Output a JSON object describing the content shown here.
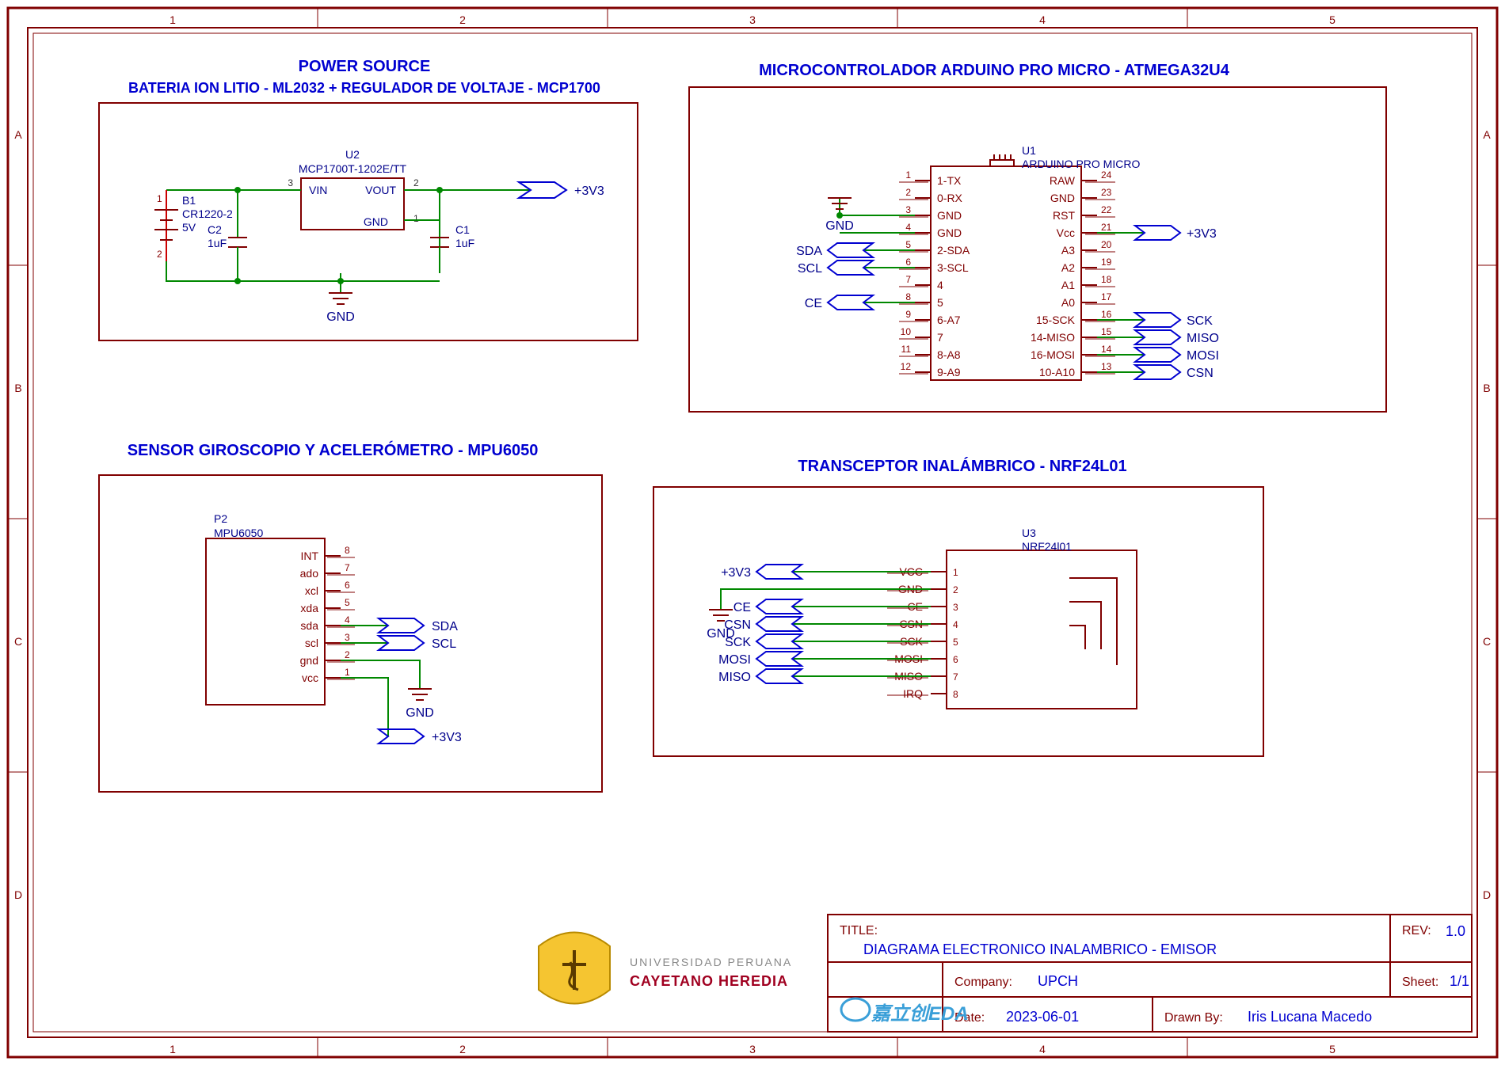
{
  "frame": {
    "cols": [
      "1",
      "2",
      "3",
      "4",
      "5"
    ],
    "rows": [
      "A",
      "B",
      "C",
      "D"
    ]
  },
  "sections": {
    "power": {
      "heading1": "POWER SOURCE",
      "heading2": "BATERIA ION LITIO - ML2032 + REGULADOR DE VOLTAJE - MCP1700",
      "b1": {
        "ref": "B1",
        "pn": "CR1220-2",
        "v": "5V"
      },
      "c2": {
        "ref": "C2",
        "val": "1uF"
      },
      "c1": {
        "ref": "C1",
        "val": "1uF"
      },
      "u2": {
        "ref": "U2",
        "pn": "MCP1700T-1202E/TT",
        "pins": {
          "vin": "VIN",
          "vout": "VOUT",
          "gnd": "GND",
          "p1": "1",
          "p2": "2",
          "p3": "3"
        }
      },
      "gnd": "GND",
      "out": "+3V3"
    },
    "mcu": {
      "heading": "MICROCONTROLADOR ARDUINO PRO MICRO - ATMEGA32U4",
      "u1": {
        "ref": "U1",
        "pn": "ARDUINO PRO MICRO"
      },
      "left_pins": [
        {
          "n": "1",
          "name": "1-TX"
        },
        {
          "n": "2",
          "name": "0-RX"
        },
        {
          "n": "3",
          "name": "GND"
        },
        {
          "n": "4",
          "name": "GND"
        },
        {
          "n": "5",
          "name": "2-SDA"
        },
        {
          "n": "6",
          "name": "3-SCL"
        },
        {
          "n": "7",
          "name": "4"
        },
        {
          "n": "8",
          "name": "5"
        },
        {
          "n": "9",
          "name": "6-A7"
        },
        {
          "n": "10",
          "name": "7"
        },
        {
          "n": "11",
          "name": "8-A8"
        },
        {
          "n": "12",
          "name": "9-A9"
        }
      ],
      "right_pins": [
        {
          "n": "24",
          "name": "RAW"
        },
        {
          "n": "23",
          "name": "GND"
        },
        {
          "n": "22",
          "name": "RST"
        },
        {
          "n": "21",
          "name": "Vcc"
        },
        {
          "n": "20",
          "name": "A3"
        },
        {
          "n": "19",
          "name": "A2"
        },
        {
          "n": "18",
          "name": "A1"
        },
        {
          "n": "17",
          "name": "A0"
        },
        {
          "n": "16",
          "name": "15-SCK"
        },
        {
          "n": "15",
          "name": "14-MISO"
        },
        {
          "n": "14",
          "name": "16-MOSI"
        },
        {
          "n": "13",
          "name": "10-A10"
        }
      ],
      "nets": {
        "gnd": "GND",
        "sda": "SDA",
        "scl": "SCL",
        "ce": "CE",
        "v33": "+3V3",
        "sck": "SCK",
        "miso": "MISO",
        "mosi": "MOSI",
        "csn": "CSN"
      }
    },
    "mpu": {
      "heading": "SENSOR GIROSCOPIO Y ACELERÓMETRO - MPU6050",
      "p2": {
        "ref": "P2",
        "pn": "MPU6050"
      },
      "pins": [
        {
          "n": "8",
          "name": "INT"
        },
        {
          "n": "7",
          "name": "ado"
        },
        {
          "n": "6",
          "name": "xcl"
        },
        {
          "n": "5",
          "name": "xda"
        },
        {
          "n": "4",
          "name": "sda"
        },
        {
          "n": "3",
          "name": "scl"
        },
        {
          "n": "2",
          "name": "gnd"
        },
        {
          "n": "1",
          "name": "vcc"
        }
      ],
      "nets": {
        "sda": "SDA",
        "scl": "SCL",
        "gnd": "GND",
        "v33": "+3V3"
      }
    },
    "nrf": {
      "heading": "TRANSCEPTOR INALÁMBRICO - NRF24L01",
      "u3": {
        "ref": "U3",
        "pn": "NRF24l01"
      },
      "pins": [
        {
          "n": "1",
          "name": "VCC"
        },
        {
          "n": "2",
          "name": "GND"
        },
        {
          "n": "3",
          "name": "CE"
        },
        {
          "n": "4",
          "name": "CSN"
        },
        {
          "n": "5",
          "name": "SCK"
        },
        {
          "n": "6",
          "name": "MOSI"
        },
        {
          "n": "7",
          "name": "MISO"
        },
        {
          "n": "8",
          "name": "IRQ"
        }
      ],
      "nets": {
        "v33": "+3V3",
        "gnd": "GND",
        "ce": "CE",
        "csn": "CSN",
        "sck": "SCK",
        "mosi": "MOSI",
        "miso": "MISO"
      }
    }
  },
  "titleblock": {
    "title_label": "TITLE:",
    "title": "DIAGRAMA ELECTRONICO INALAMBRICO - EMISOR",
    "rev_label": "REV:",
    "rev": "1.0",
    "company_label": "Company:",
    "company": "UPCH",
    "sheet_label": "Sheet:",
    "sheet": "1/1",
    "date_label": "Date:",
    "date": "2023-06-01",
    "drawn_label": "Drawn By:",
    "drawn": "Iris Lucana Macedo",
    "org_top": "UNIVERSIDAD PERUANA",
    "org_bot": "CAYETANO HEREDIA",
    "eda": "嘉立创EDA"
  }
}
